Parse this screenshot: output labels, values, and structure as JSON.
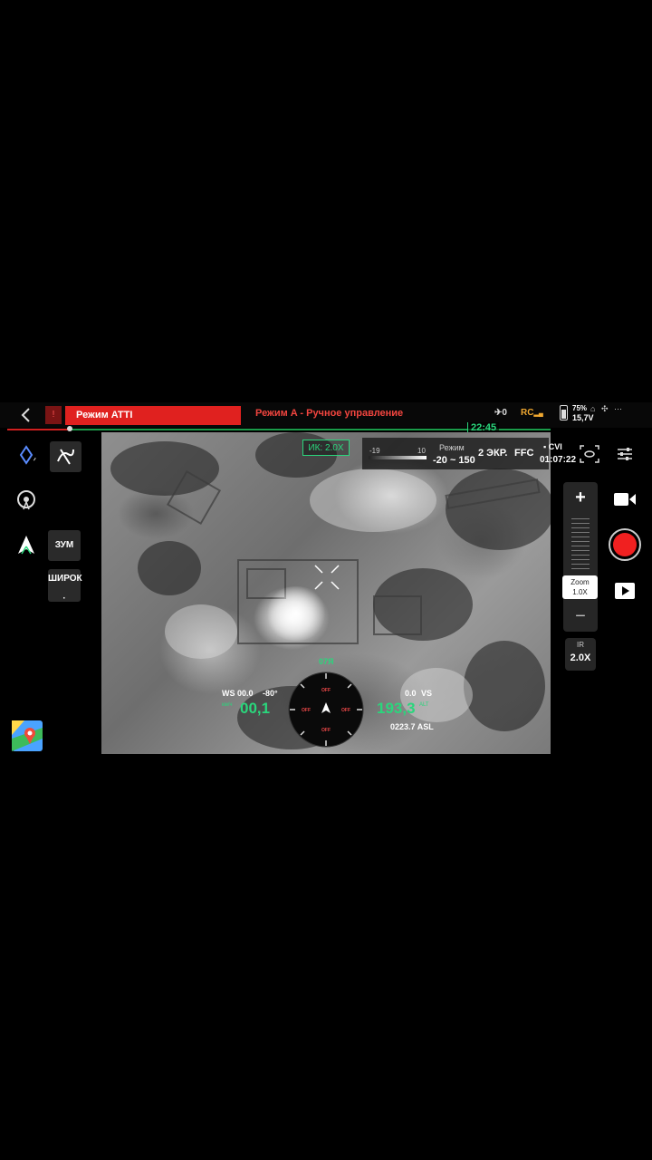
{
  "header": {
    "back_icon": "chevron-left-icon",
    "flight_mode": "Режим ATTI",
    "control_mode": "Режим A - Ручное управление",
    "gps_count": "0",
    "rc_label": "RC",
    "battery_percent": "75%",
    "battery_voltage": "15,7V",
    "timer": "22:45"
  },
  "camera": {
    "ir_zoom_tag": "ИК: 2.0X",
    "temp_min": "-19",
    "temp_max": "10",
    "mode_label": "Режим",
    "temp_range": "-20 ~ 150",
    "screens": "2 ЭКР.",
    "ffc": "FFC",
    "cvi": "CVI",
    "rec_time": "01:07:22"
  },
  "left_toolbar": {
    "zoom_label": "ЗУМ",
    "wide_label": "ШИРОК"
  },
  "zoom_panel": {
    "plus": "+",
    "minus": "−",
    "zoom_title": "Zoom",
    "zoom_value": "1.0X",
    "ir_label": "IR",
    "ir_value": "2.0X"
  },
  "telemetry": {
    "heading": "07Я",
    "ws_label": "WS 00.0",
    "pitch": "-80°",
    "hs_unit": "км/ч",
    "horizontal_speed": "00,1",
    "vs_value": "0.0",
    "vs_label": "VS",
    "altitude": "193,3",
    "alt_label": "ALT",
    "asl": "0223.7 ASL",
    "compass_off_label": "OFF"
  },
  "colors": {
    "accent_green": "#2ad67c",
    "alert_red": "#e0211f",
    "rc_orange": "#f0a830"
  }
}
